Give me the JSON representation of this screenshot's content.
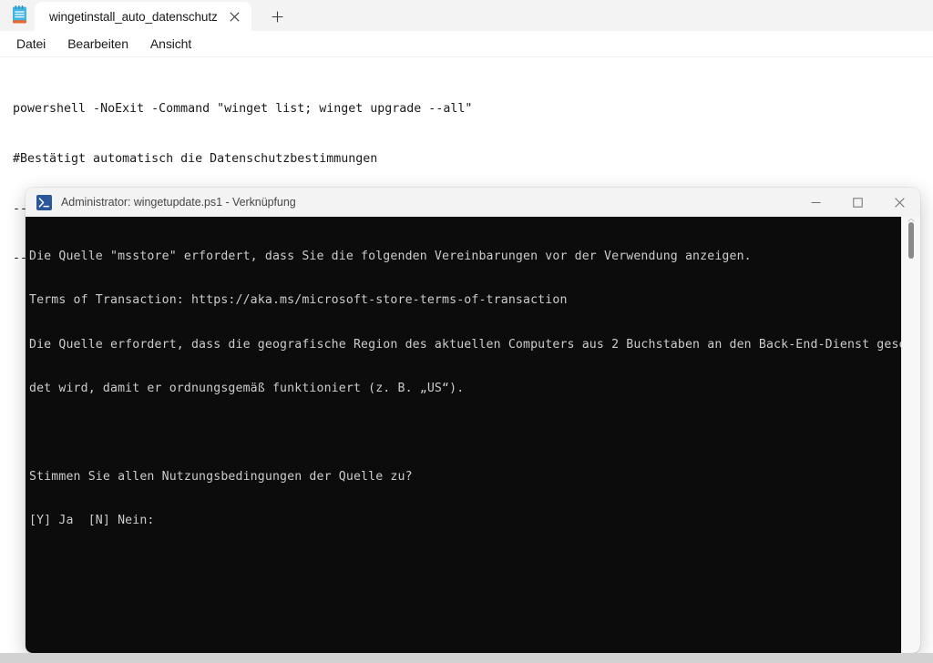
{
  "notepad": {
    "app_icon": "notepad-icon",
    "tabs": [
      {
        "title": "wingetinstall_auto_datenschutz_ja",
        "close_icon": "close-icon",
        "active": true
      }
    ],
    "new_tab_icon": "plus-icon",
    "menu": [
      "Datei",
      "Bearbeiten",
      "Ansicht"
    ],
    "document_lines": [
      "powershell -NoExit -Command \"winget list; winget upgrade --all\"",
      "#Bestätigt automatisch die Datenschutzbestimmungen",
      "--accept-source-agreements",
      "--accept-package-agreements"
    ]
  },
  "console": {
    "icon": "powershell-icon",
    "title": "Administrator: wingetupdate.ps1 - Verknüpfung",
    "controls": [
      {
        "name": "minimize-button",
        "glyph": "—"
      },
      {
        "name": "maximize-button",
        "glyph": "▢"
      },
      {
        "name": "close-button",
        "glyph": "✕"
      }
    ],
    "output_lines": [
      "Die Quelle \"msstore\" erfordert, dass Sie die folgenden Vereinbarungen vor der Verwendung anzeigen.",
      "Terms of Transaction: https://aka.ms/microsoft-store-terms-of-transaction",
      "Die Quelle erfordert, dass die geografische Region des aktuellen Computers aus 2 Buchstaben an den Back-End-Dienst gesen",
      "det wird, damit er ordnungsgemäß funktioniert (z. B. „US“).",
      "",
      "Stimmen Sie allen Nutzungsbedingungen der Quelle zu?",
      "[Y] Ja  [N] Nein:"
    ],
    "scrollbar": {
      "thumb": "scroll-thumb",
      "up_arrow_icon": "chevron-up-icon"
    }
  },
  "colors": {
    "console_bg": "#0c0c0c",
    "console_fg": "#cccccc",
    "titlebar_bg": "#f3f3f3",
    "powershell_blue": "#2b579a",
    "notepad_blue": "#41b6e6"
  }
}
